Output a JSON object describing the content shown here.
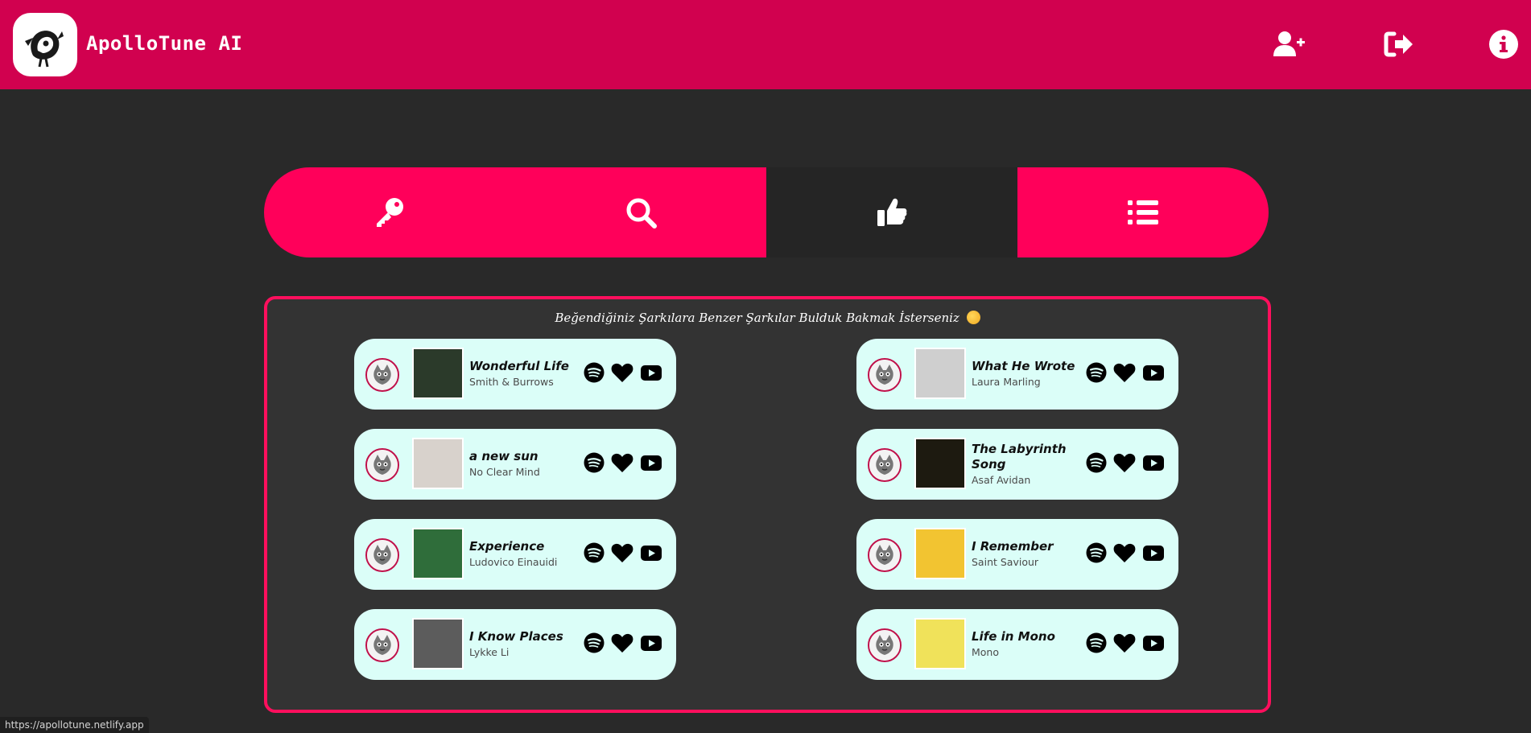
{
  "header": {
    "app_title": "ApolloTune AI",
    "buttons": [
      "add-user-icon",
      "logout-icon",
      "info-icon"
    ],
    "brand_color": "#d1014f"
  },
  "tabs": [
    {
      "icon": "key-icon",
      "active": false
    },
    {
      "icon": "search-icon",
      "active": false
    },
    {
      "icon": "thumbs-up-icon",
      "active": true
    },
    {
      "icon": "list-icon",
      "active": false
    }
  ],
  "results": {
    "heading": "Beğendiğiniz Şarkılara Benzer Şarkılar Bulduk Bakmak İsterseniz",
    "songs": [
      {
        "title": "Wonderful Life",
        "artist": "Smith & Burrows",
        "cover_color": "#2b3a2a"
      },
      {
        "title": "What He Wrote",
        "artist": "Laura Marling",
        "cover_color": "#cfcfcf"
      },
      {
        "title": "a new sun",
        "artist": "No Clear Mind",
        "cover_color": "#d8d2cc"
      },
      {
        "title": "The Labyrinth Song",
        "artist": "Asaf Avidan",
        "cover_color": "#1d1a10"
      },
      {
        "title": "Experience",
        "artist": "Ludovico Einauidi",
        "cover_color": "#2f6d3a"
      },
      {
        "title": "I Remember",
        "artist": "Saint Saviour",
        "cover_color": "#f2c431"
      },
      {
        "title": "I Know Places",
        "artist": "Lykke Li",
        "cover_color": "#5c5c5c"
      },
      {
        "title": "Life in Mono",
        "artist": "Mono",
        "cover_color": "#f0e25a"
      }
    ]
  },
  "status_bar": {
    "url": "https://apollotune.netlify.app"
  }
}
